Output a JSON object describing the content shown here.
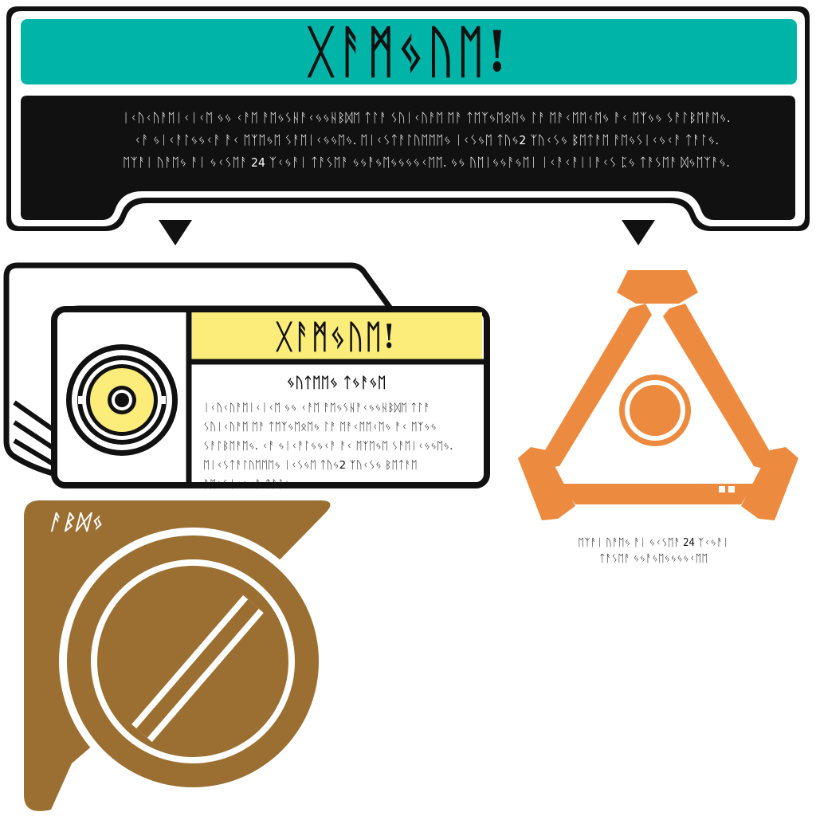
{
  "banner": {
    "title": "ᚷᚨᛗᛃᚢᛖ!",
    "body": "ᛁᚲᚢᚲᚢᚨᛖᛁᚲᛁᚲᛖ ᛃᛃ ᚲᚨᛖ ᚨᛖᛃᛊᚺᚨᚲᛃᛃᚺᛒᛞᛖ ᛏᛚᚨ ᛊᚢᛁᚲᚢᚨᛖ ᛖᚨ ᛏᛖᛉᛃᛖᛟᛖᛃ ᛚᚨ ᛖᚨᚲᛖᛖᚲᛖᛃ ᚨᚲ ᛖᛉᛃᛃ ᛊᚨᛚᛒᛖᚨᛖᛃ. ᚲᚨ ᛃᛁᚲᚨᛚᛃᛃᚲᚨ ᚨᚲ ᛖᛉᛖᛃᛖ ᛊᚨᛖᛁᚲᛃᛃᛖᛃ. ᛖᛁᚲᛊᛏᚨᛚᚢᛖᛖᛖᛃ ᛁᚲᛊᛃᛖ ᛏᚢᛃ2 ᛉᚢᚲᛊᛃ ᛒᛖᛏᚨᛖ ᚨᛖᛃᛊᛁᚲᛃᚲᚨ ᛏᚨᛚᛃ. ᛖᛉᚨᛁ ᚢᚨᛖᛃ ᚨᛁ ᛃᚲᛊᛖᚨ 24 ᛉᚲᛃᚨᛁ ᛏᚨᛊᛖᚨ ᛃᛃᚨᛃᛖᛃᛃᛃᛃᚲᛖᛖ. ᛃᛃ ᚢᛖᛁᛃᛃᚨᛃᛖᛁ ᛁᚲᚨᚲᚨᛁᛁᚨᚲᛊ ᛈᛃ ᛏᚨᛊᛖᚨ ᛞᛃᛖᛉᚨᛃ."
  },
  "card": {
    "title": "ᚷᚨᛗᛃᚢᛖ!",
    "subtitle": "ᛃᚢᛏᛖᛖᛃ ᛏᛃᚨᛃᛖ",
    "text": "ᛁᚲᚢᚲᚢᚨᛖᛁᚲᛁᚲᛖ ᛃᛃ ᚲᚨᛖ ᚨᛖᛃᛊᚺᚨᚲᛃᛃᚺᛒᛞᛖ ᛏᛚᚨ ᛊᚢᛁᚲᚢᚨᛖ ᛖᚨ ᛏᛖᛉᛃᛖᛟᛖᛃ ᛚᚨ ᛖᚨᚲᛖᛖᚲᛖᛃ ᚨᚲ ᛖᛉᛃᛃ ᛊᚨᛚᛒᛖᚨᛖᛃ. ᚲᚨ ᛃᛁᚲᚨᛚᛃᛃᚲᚨ ᚨᚲ ᛖᛉᛖᛃᛖ ᛊᚨᛖᛁᚲᛃᛃᛖᛃ. ᛖᛁᚲᛊᛏᚨᛚᚢᛖᛖᛖᛃ ᛁᚲᛊᛃᛖ ᛏᚢᛃ2 ᛉᚢᚲᛊᛃ ᛒᛖᛏᚨᛖ ᚨᛖᛃᛊᛁᚲᛃᚲᚨ ᛏᚨᛚᛃ."
  },
  "orange_symbol": {
    "caption_line1": "ᛖᛉᚨᛁ ᚢᚨᛖᛃ ᚨᛁ ᛃᚲᛊᛖᚨ 24 ᛉᚲᛃᚨᛁ",
    "caption_line2": "ᛏᚨᛊᛖᚨ ᛃᛃᚨᛃᛖᛃᛃᛃᛃᚲᛖᛖ"
  },
  "gold_symbol": {
    "label": "ᚨᛒᛞᛃ"
  },
  "colors": {
    "teal": "#00b5a8",
    "black": "#111111",
    "yellow": "#fced7a",
    "orange": "#ec8a3f",
    "gold": "#9a6f31"
  }
}
